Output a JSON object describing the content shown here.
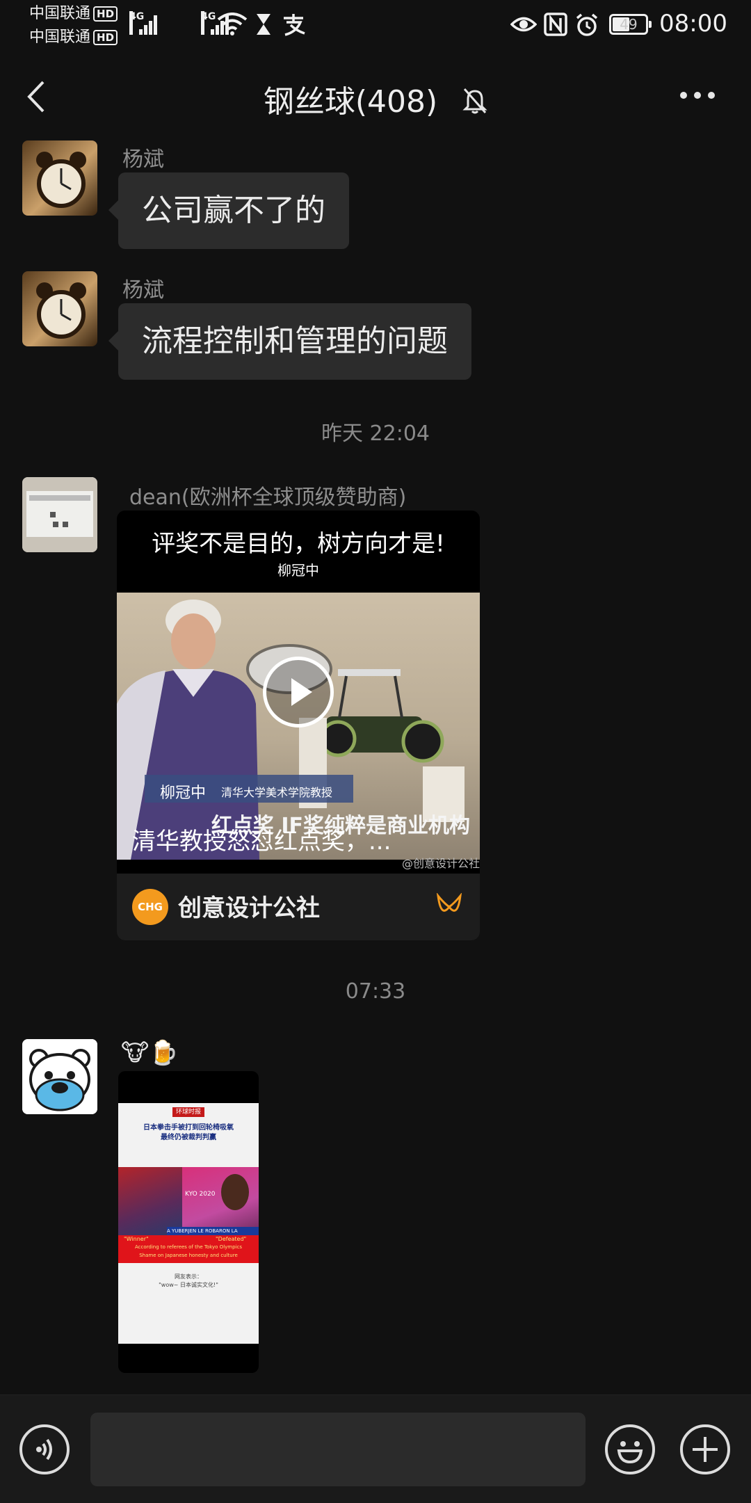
{
  "status_bar": {
    "carrier1": "中国联通",
    "carrier2": "中国联通",
    "hd_badge": "HD",
    "network": "4G",
    "battery": "49",
    "clock": "08:00"
  },
  "header": {
    "title": "钢丝球(408)"
  },
  "messages": [
    {
      "sender": "杨斌",
      "text": "公司赢不了的"
    },
    {
      "sender": "杨斌",
      "text": "流程控制和管理的问题"
    }
  ],
  "timestamp1": "昨天 22:04",
  "video_message": {
    "sender": "dean(欧洲杯全球顶级赞助商)",
    "headline": "评奖不是目的，树方向才是!",
    "byline": "柳冠中",
    "name_tag": "柳冠中",
    "name_caption": "清华大学美术学院教授",
    "subtitle": "红点奖  IF奖纯粹是商业机构",
    "video_title": "清华教授怒怼红点奖，...",
    "watermark": "@创意设计公社",
    "channel_name": "创意设计公社",
    "channel_logo_text": "CHG"
  },
  "timestamp2": "07:33",
  "image_message": {
    "sender_emoji": "🐮🍺",
    "poster": {
      "logo": "环球时报",
      "headline_line1": "日本拳击手被打到回轮椅吸氧",
      "headline_line2": "最终仍被裁判判赢",
      "kyo": "KYO 2020",
      "name_strip": "A YUBERJEN LE ROBARON LA",
      "winner": "\"Winner\"",
      "defeated": "\"Defeated\"",
      "band_line1": "According to referees of the Tokyo Olympics",
      "band_line2": "Shame on Japanese honesty and culture",
      "footer_line1": "网友表示：",
      "footer_line2": "\"wow~ 日本诚实文化!\""
    }
  },
  "colors": {
    "background": "#111111",
    "bubble": "#2c2c2c",
    "accent_orange": "#f39a1e"
  }
}
